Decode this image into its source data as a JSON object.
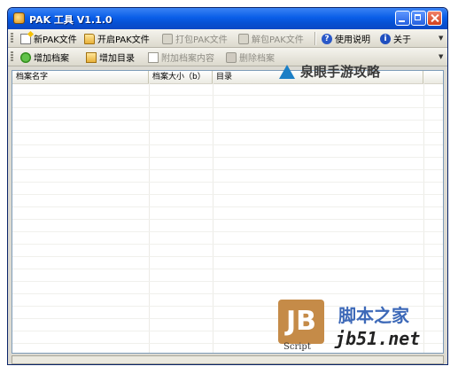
{
  "window": {
    "title": "PAK 工具 V1.1.0"
  },
  "toolbar1": {
    "new_pak": "新PAK文件",
    "open_pak": "开启PAK文件",
    "pack_pak": "打包PAK文件",
    "unpack_pak": "解包PAK文件",
    "help": "使用说明",
    "about": "关于"
  },
  "toolbar2": {
    "add_file": "增加档案",
    "add_dir": "增加目录",
    "append_content": "附加档案内容",
    "delete_file": "删除档案"
  },
  "list": {
    "columns": [
      "档案名字",
      "档案大小（b）",
      "目录"
    ]
  },
  "watermarks": {
    "top": "泉眼手游攻略",
    "logo": "JB",
    "script": "Script",
    "site_cn": "脚本之家",
    "site_url": "jb51.net"
  },
  "colors": {
    "titlebar": "#0a5ee8",
    "window_bg": "#dcdad2",
    "watermark_blue": "#3d69b8"
  },
  "icons": [
    "app-icon",
    "new-file-icon",
    "open-folder-icon",
    "pack-icon",
    "unpack-icon",
    "help-icon",
    "info-icon",
    "add-file-icon",
    "add-dir-icon",
    "document-icon",
    "delete-icon"
  ]
}
